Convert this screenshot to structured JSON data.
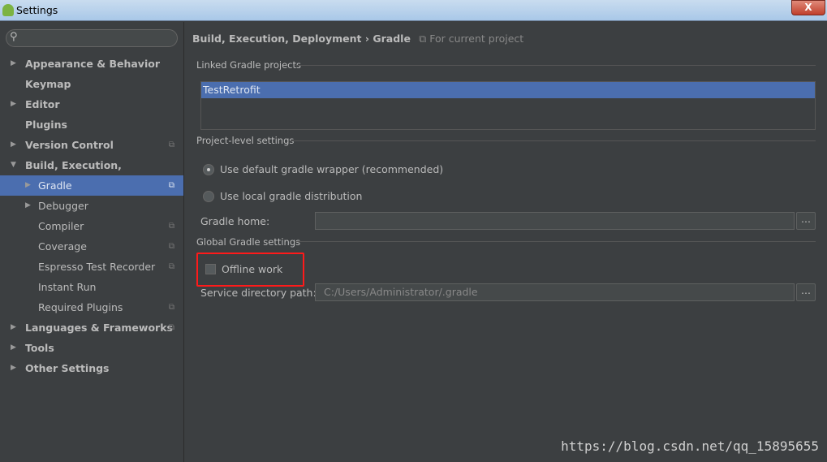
{
  "window": {
    "title": "Settings",
    "close": "X"
  },
  "sidebar": {
    "search_placeholder": "",
    "items": [
      {
        "label": "Appearance & Behavior",
        "arrow": "▶",
        "bold": true
      },
      {
        "label": "Keymap",
        "bold": true
      },
      {
        "label": "Editor",
        "arrow": "▶",
        "bold": true
      },
      {
        "label": "Plugins",
        "bold": true
      },
      {
        "label": "Version Control",
        "arrow": "▶",
        "bold": true,
        "copy": true
      },
      {
        "label": "Build, Execution, Deployment",
        "arrow": "▼",
        "bold": true
      },
      {
        "label": "Gradle",
        "arrow": "▶",
        "selected": true,
        "copy": true
      },
      {
        "label": "Debugger",
        "arrow": "▶"
      },
      {
        "label": "Compiler",
        "copy": true
      },
      {
        "label": "Coverage",
        "copy": true
      },
      {
        "label": "Espresso Test Recorder",
        "copy": true
      },
      {
        "label": "Instant Run"
      },
      {
        "label": "Required Plugins",
        "copy": true
      },
      {
        "label": "Languages & Frameworks",
        "arrow": "▶",
        "bold": true,
        "copy": true
      },
      {
        "label": "Tools",
        "arrow": "▶",
        "bold": true
      },
      {
        "label": "Other Settings",
        "arrow": "▶",
        "bold": true
      }
    ]
  },
  "main": {
    "breadcrumb": {
      "parent": "Build, Execution, Deployment",
      "sep": "›",
      "current": "Gradle",
      "scope": "For current project"
    },
    "linked_title": "Linked Gradle projects",
    "linked_projects": [
      "TestRetrofit"
    ],
    "project_title": "Project-level settings",
    "radio_default": "Use default gradle wrapper (recommended)",
    "radio_local": "Use local gradle distribution",
    "gradle_home_label": "Gradle home:",
    "gradle_home_value": "",
    "browse": "...",
    "global_title": "Global Gradle settings",
    "offline_label": "Offline work",
    "service_label": "Service directory path:",
    "service_value": "C:/Users/Administrator/.gradle"
  },
  "watermark": "https://blog.csdn.net/qq_15895655"
}
